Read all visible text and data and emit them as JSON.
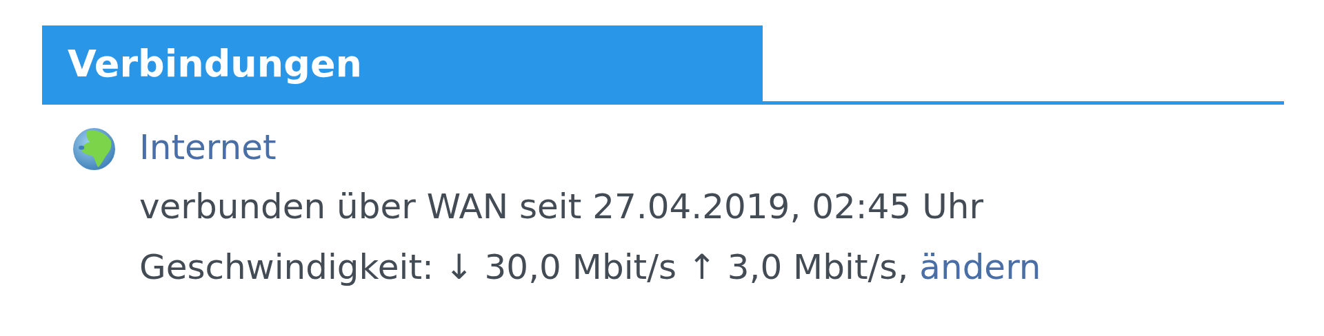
{
  "section": {
    "title": "Verbindungen"
  },
  "connections": [
    {
      "name": "Internet",
      "status": "verbunden über WAN seit 27.04.2019, 02:45 Uhr",
      "speed": "Geschwindigkeit: ↓ 30,0 Mbit/s ↑ 3,0 Mbit/s,",
      "link": "ändern"
    }
  ]
}
